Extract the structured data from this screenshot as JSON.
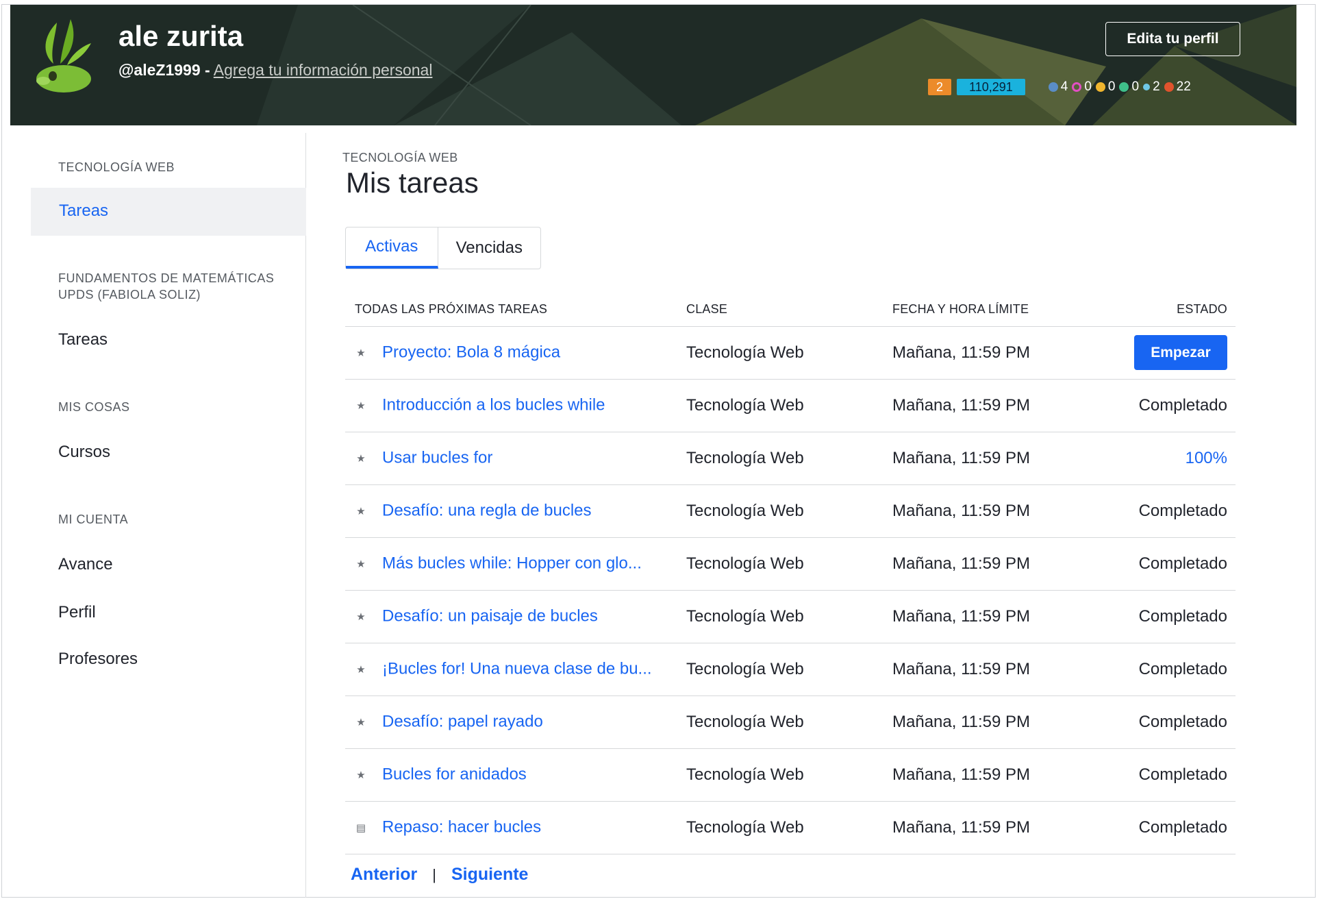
{
  "profile": {
    "name": "ale zurita",
    "handle": "@aleZ1999 -",
    "add_info_link": "Agrega tu información personal",
    "edit_button": "Edita tu perfil",
    "streak": "2",
    "points": "110,291",
    "badges": [
      {
        "icon": "meteorite-badge-icon",
        "count": "4",
        "color": "#5a8dc7"
      },
      {
        "icon": "moon-badge-icon",
        "count": "0",
        "color": "#e24fc3"
      },
      {
        "icon": "earth-badge-icon",
        "count": "0",
        "color": "#f0b52e"
      },
      {
        "icon": "sun-badge-icon",
        "count": "0",
        "color": "#3fbf8a"
      },
      {
        "icon": "black-hole-badge-icon",
        "count": "2",
        "color": "#6fc7e6"
      },
      {
        "icon": "challenge-patch-icon",
        "count": "22",
        "color": "#e0532d"
      }
    ]
  },
  "sidebar": {
    "sections": [
      {
        "heading": "TECNOLOGÍA WEB",
        "items": [
          "Tareas"
        ]
      },
      {
        "heading": "FUNDAMENTOS DE MATEMÁTICAS UPDS (FABIOLA SOLIZ)",
        "items": [
          "Tareas"
        ]
      },
      {
        "heading": "MIS COSAS",
        "items": [
          "Cursos"
        ]
      },
      {
        "heading": "MI CUENTA",
        "items": [
          "Avance",
          "Perfil",
          "Profesores"
        ]
      }
    ]
  },
  "main": {
    "eyebrow": "TECNOLOGÍA WEB",
    "title": "Mis tareas",
    "tabs": [
      "Activas",
      "Vencidas"
    ],
    "columns": [
      "TODAS LAS PRÓXIMAS TAREAS",
      "CLASE",
      "FECHA Y HORA LÍMITE",
      "ESTADO"
    ],
    "rows": [
      {
        "icon": "star-icon",
        "title": "Proyecto: Bola 8 mágica",
        "class": "Tecnología Web",
        "due": "Mañana, 11:59 PM",
        "status": "Empezar",
        "status_type": "button"
      },
      {
        "icon": "star-icon",
        "title": "Introducción a los bucles while",
        "class": "Tecnología Web",
        "due": "Mañana, 11:59 PM",
        "status": "Completado",
        "status_type": "text"
      },
      {
        "icon": "star-icon",
        "title": "Usar bucles for",
        "class": "Tecnología Web",
        "due": "Mañana, 11:59 PM",
        "status": "100%",
        "status_type": "link"
      },
      {
        "icon": "star-icon",
        "title": "Desafío: una regla de bucles",
        "class": "Tecnología Web",
        "due": "Mañana, 11:59 PM",
        "status": "Completado",
        "status_type": "text"
      },
      {
        "icon": "star-icon",
        "title": "Más bucles while: Hopper con glo...",
        "class": "Tecnología Web",
        "due": "Mañana, 11:59 PM",
        "status": "Completado",
        "status_type": "text"
      },
      {
        "icon": "star-icon",
        "title": "Desafío: un paisaje de bucles",
        "class": "Tecnología Web",
        "due": "Mañana, 11:59 PM",
        "status": "Completado",
        "status_type": "text"
      },
      {
        "icon": "star-icon",
        "title": "¡Bucles for! Una nueva clase de bu...",
        "class": "Tecnología Web",
        "due": "Mañana, 11:59 PM",
        "status": "Completado",
        "status_type": "text"
      },
      {
        "icon": "star-icon",
        "title": "Desafío: papel rayado",
        "class": "Tecnología Web",
        "due": "Mañana, 11:59 PM",
        "status": "Completado",
        "status_type": "text"
      },
      {
        "icon": "star-icon",
        "title": "Bucles for anidados",
        "class": "Tecnología Web",
        "due": "Mañana, 11:59 PM",
        "status": "Completado",
        "status_type": "text"
      },
      {
        "icon": "article-icon",
        "title": "Repaso: hacer bucles",
        "class": "Tecnología Web",
        "due": "Mañana, 11:59 PM",
        "status": "Completado",
        "status_type": "text"
      }
    ],
    "pager": {
      "prev": "Anterior",
      "separator": "|",
      "next": "Siguiente"
    }
  },
  "colors": {
    "accent": "#1865f2",
    "banner": "#1f2b26",
    "streak": "#ec8b2a",
    "points": "#1ab2dd"
  }
}
